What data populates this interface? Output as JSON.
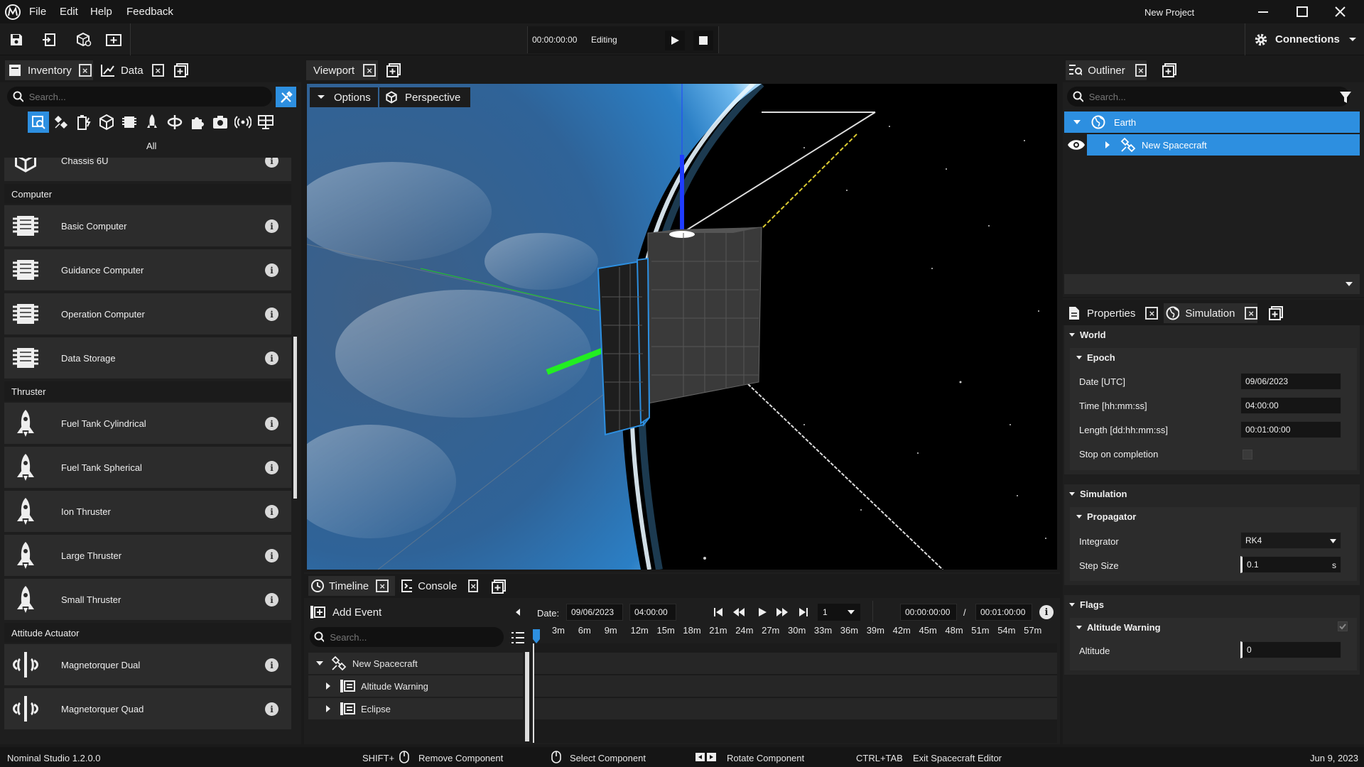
{
  "app": {
    "title": "New Project",
    "version": "Nominal Studio 1.2.0.0",
    "date": "Jun 9, 2023"
  },
  "menu": [
    "File",
    "Edit",
    "Help",
    "Feedback"
  ],
  "toolbar": {
    "time": "00:00:00:00",
    "mode": "Editing",
    "connections": "Connections"
  },
  "left_tabs": {
    "inventory": "Inventory",
    "data": "Data"
  },
  "inventory": {
    "search_placeholder": "Search...",
    "filter_label": "All",
    "items": [
      {
        "type": "item",
        "label": "Chassis 6U",
        "icon": "cube-icon"
      },
      {
        "type": "category",
        "label": "Computer"
      },
      {
        "type": "item",
        "label": "Basic Computer",
        "icon": "chip-icon"
      },
      {
        "type": "item",
        "label": "Guidance Computer",
        "icon": "chip-icon"
      },
      {
        "type": "item",
        "label": "Operation Computer",
        "icon": "chip-icon"
      },
      {
        "type": "item",
        "label": "Data Storage",
        "icon": "chip-icon"
      },
      {
        "type": "category",
        "label": "Thruster"
      },
      {
        "type": "item",
        "label": "Fuel Tank Cylindrical",
        "icon": "rocket-icon"
      },
      {
        "type": "item",
        "label": "Fuel Tank Spherical",
        "icon": "rocket-icon"
      },
      {
        "type": "item",
        "label": "Ion Thruster",
        "icon": "rocket-icon"
      },
      {
        "type": "item",
        "label": "Large Thruster",
        "icon": "rocket-icon"
      },
      {
        "type": "item",
        "label": "Small Thruster",
        "icon": "rocket-icon"
      },
      {
        "type": "category",
        "label": "Attitude Actuator"
      },
      {
        "type": "item",
        "label": "Magnetorquer Dual",
        "icon": "magnetorquer-icon"
      },
      {
        "type": "item",
        "label": "Magnetorquer Quad",
        "icon": "magnetorquer-icon"
      }
    ]
  },
  "viewport": {
    "tab": "Viewport",
    "options": "Options",
    "perspective": "Perspective"
  },
  "outliner": {
    "tab": "Outliner",
    "search_placeholder": "Search...",
    "tree": [
      {
        "label": "Earth"
      },
      {
        "label": "New Spacecraft"
      }
    ]
  },
  "properties": {
    "tabs": {
      "properties": "Properties",
      "simulation": "Simulation"
    },
    "world": "World",
    "epoch": "Epoch",
    "date_label": "Date [UTC]",
    "date_value": "09/06/2023",
    "time_label": "Time [hh:mm:ss]",
    "time_value": "04:00:00",
    "length_label": "Length [dd:hh:mm:ss]",
    "length_value": "00:01:00:00",
    "stop_label": "Stop on completion",
    "simulation": "Simulation",
    "propagator": "Propagator",
    "integrator_label": "Integrator",
    "integrator_value": "RK4",
    "step_label": "Step Size",
    "step_value": "0.1",
    "step_unit": "s",
    "flags": "Flags",
    "altitude_warning": "Altitude Warning",
    "altitude_label": "Altitude",
    "altitude_value": "0"
  },
  "timeline": {
    "tabs": {
      "timeline": "Timeline",
      "console": "Console"
    },
    "add_event": "Add Event",
    "search_placeholder": "Search...",
    "date_label": "Date:",
    "date_value": "09/06/2023",
    "time_value": "04:00:00",
    "speed": "1",
    "current_time": "00:00:00:00",
    "separator": "/",
    "end_time": "00:01:00:00",
    "ticks": [
      "3m",
      "6m",
      "9m",
      "12m",
      "15m",
      "18m",
      "21m",
      "24m",
      "27m",
      "30m",
      "33m",
      "36m",
      "39m",
      "42m",
      "45m",
      "48m",
      "51m",
      "54m",
      "57m"
    ],
    "rows": [
      {
        "label": "New Spacecraft"
      },
      {
        "label": "Altitude Warning"
      },
      {
        "label": "Eclipse"
      }
    ]
  },
  "status": {
    "shift_key": "SHIFT+",
    "remove": "Remove Component",
    "select": "Select Component",
    "rotate": "Rotate Component",
    "ctrl_key": "CTRL+TAB",
    "exit": "Exit Spacecraft Editor"
  },
  "colors": {
    "accent": "#2d8fe0",
    "selected": "#2d8fe0",
    "panel": "#2c2c2c",
    "dark": "#1a1a1a"
  }
}
